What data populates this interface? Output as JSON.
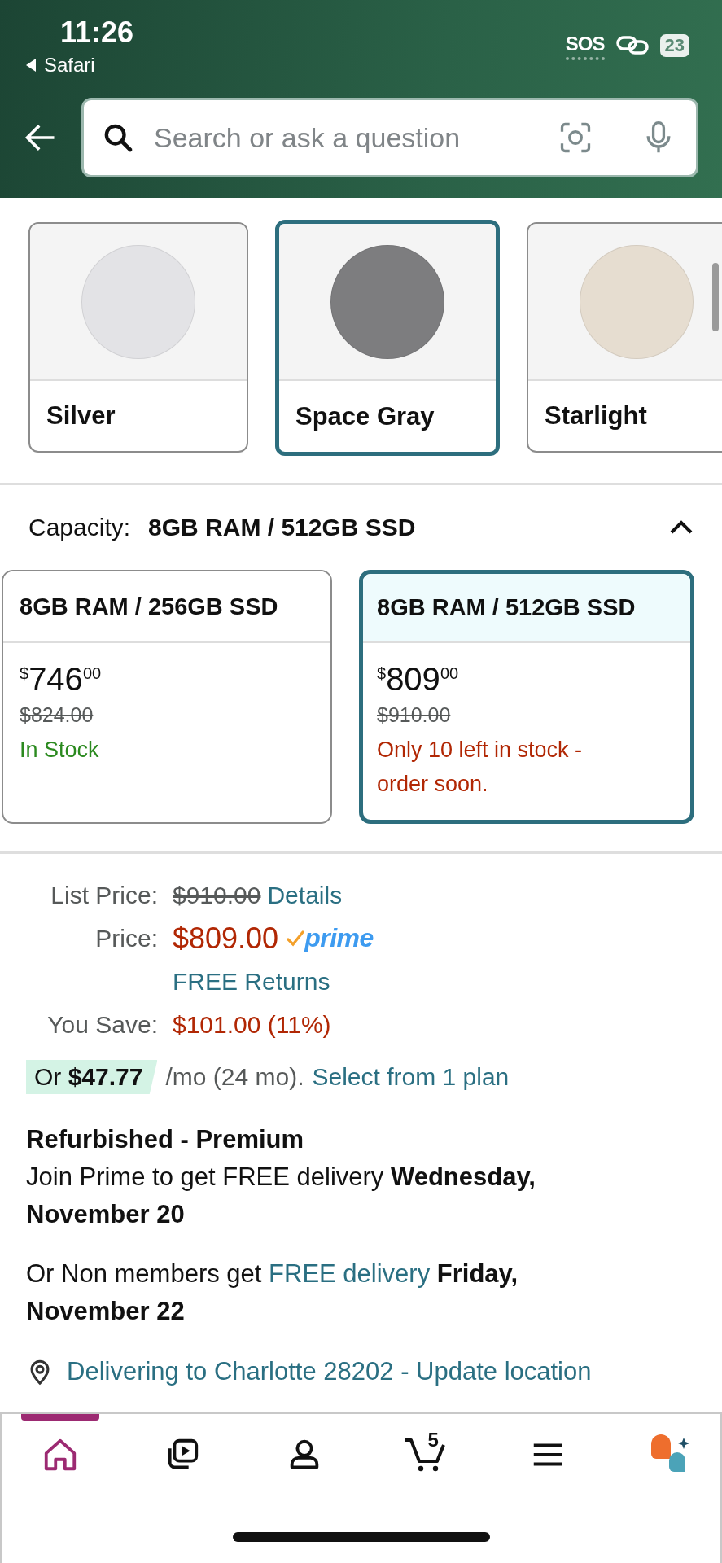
{
  "status_bar": {
    "time": "11:26",
    "back_app": "Safari",
    "carrier": "SOS",
    "battery": "23"
  },
  "search": {
    "placeholder": "Search or ask a question"
  },
  "colors": [
    {
      "label": "Silver",
      "color": "#e3e3e6",
      "selected": false
    },
    {
      "label": "Space Gray",
      "color": "#7d7d7f",
      "selected": true
    },
    {
      "label": "Starlight",
      "color": "#e6ddd0",
      "selected": false
    }
  ],
  "capacity": {
    "label": "Capacity:",
    "value": "8GB RAM / 512GB SSD",
    "expanded": true
  },
  "capacity_options": [
    {
      "title": "8GB RAM / 256GB SSD",
      "currency": "$",
      "price_whole": "746",
      "price_fraction": "00",
      "list_price": "$824.00",
      "availability": "In Stock",
      "kind": "in_stock",
      "selected": false
    },
    {
      "title": "8GB RAM / 512GB SSD",
      "currency": "$",
      "price_whole": "809",
      "price_fraction": "00",
      "list_price": "$910.00",
      "availability": "Only 10 left in stock - order soon.",
      "kind": "low_stock",
      "selected": true
    }
  ],
  "pricing": {
    "list_price_label": "List Price:",
    "list_price": "$910.00",
    "details_link": "Details",
    "price_label": "Price:",
    "price": "$809.00",
    "prime": "prime",
    "returns": "FREE Returns",
    "save_label": "You Save:",
    "save_value": "$101.00 (11%)",
    "installment": {
      "badge": "Or **$47.77**",
      "terms": "/mo (24 mo).",
      "link": "Select from 1 plan"
    }
  },
  "delivery": {
    "condition": "Refurbished - Premium",
    "prime_line": "Join Prime to get FREE delivery **Wednesday, November 20**",
    "nonmember_prefix": "Or Non members get",
    "nonmember_link": "FREE delivery",
    "nonmember_date": "Friday, November 22",
    "location": "Delivering to Charlotte 28202 - Update location"
  },
  "nav": [
    {
      "kind": "home",
      "selected": true
    },
    {
      "kind": "video",
      "selected": false
    },
    {
      "kind": "account",
      "selected": false
    },
    {
      "kind": "cart",
      "badge": "5",
      "selected": false
    },
    {
      "kind": "menu",
      "selected": false
    },
    {
      "kind": "assistant",
      "selected": false
    }
  ]
}
